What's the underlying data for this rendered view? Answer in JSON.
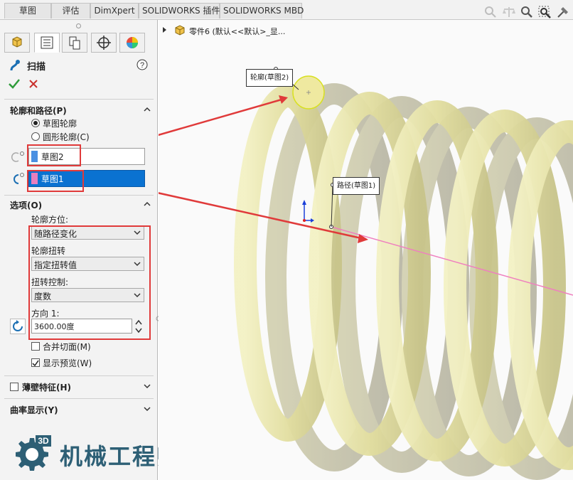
{
  "tabs": [
    "草图",
    "评估",
    "DimXpert",
    "SOLIDWORKS 插件",
    "SOLIDWORKS MBD"
  ],
  "tree": {
    "part_label": "零件6  (默认<<默认>_显..."
  },
  "feature": {
    "title": "扫描"
  },
  "sections": {
    "profile_path": "轮廓和路径(P)",
    "options": "选项(O)",
    "thin": "薄壁特征(H)",
    "curvature": "曲率显示(Y)"
  },
  "radio": {
    "sketch_profile": "草图轮廓",
    "circle_profile": "圆形轮廓(C)"
  },
  "inputs": {
    "profile": "草图2",
    "path": "草图1",
    "direction_value": "3600.00度"
  },
  "options": {
    "orientation_label": "轮廓方位:",
    "orientation_value": "随路径变化",
    "twist_label": "轮廓扭转",
    "twist_value": "指定扭转值",
    "twist_control_label": "扭转控制:",
    "twist_control_value": "度数",
    "direction_label": "方向 1:",
    "merge_faces": "合并切面(M)",
    "show_preview": "显示预览(W)"
  },
  "callouts": {
    "profile": "轮廓(草图2)",
    "path": "路径(草图1)"
  },
  "watermark": {
    "badge": "3D",
    "text": "机械工程师笔记"
  },
  "colors": {
    "accent_blue": "#0a72d1",
    "highlight_red": "#e03a3a",
    "spring": "#e6e3a6",
    "logo": "#2d5f75"
  }
}
